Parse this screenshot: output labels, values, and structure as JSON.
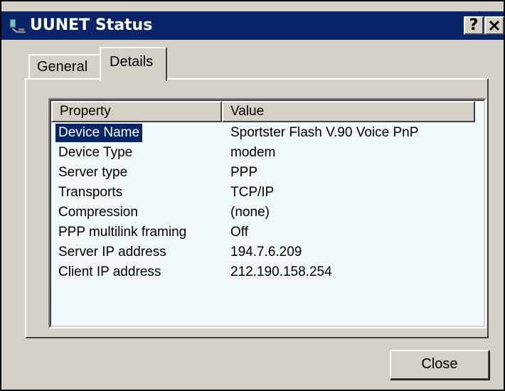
{
  "window": {
    "title": "UUNET Status",
    "help_label": "?",
    "close_label": "✕"
  },
  "tabs": [
    {
      "label": "General",
      "active": false
    },
    {
      "label": "Details",
      "active": true
    }
  ],
  "list": {
    "columns": [
      "Property",
      "Value"
    ],
    "rows": [
      {
        "property": "Device Name",
        "value": "Sportster Flash V.90 Voice PnP",
        "selected": true
      },
      {
        "property": "Device Type",
        "value": "modem",
        "selected": false
      },
      {
        "property": "Server type",
        "value": "PPP",
        "selected": false
      },
      {
        "property": "Transports",
        "value": "TCP/IP",
        "selected": false
      },
      {
        "property": "Compression",
        "value": "(none)",
        "selected": false
      },
      {
        "property": "PPP multilink framing",
        "value": "Off",
        "selected": false
      },
      {
        "property": "Server IP address",
        "value": "194.7.6.209",
        "selected": false
      },
      {
        "property": "Client IP address",
        "value": "212.190.158.254",
        "selected": false
      }
    ]
  },
  "buttons": {
    "close_label": "Close"
  },
  "colors": {
    "titlebar": "#0a246a",
    "face": "#d4d0c8",
    "selection": "#0a246a",
    "list_bg": "#f0f8fc"
  }
}
